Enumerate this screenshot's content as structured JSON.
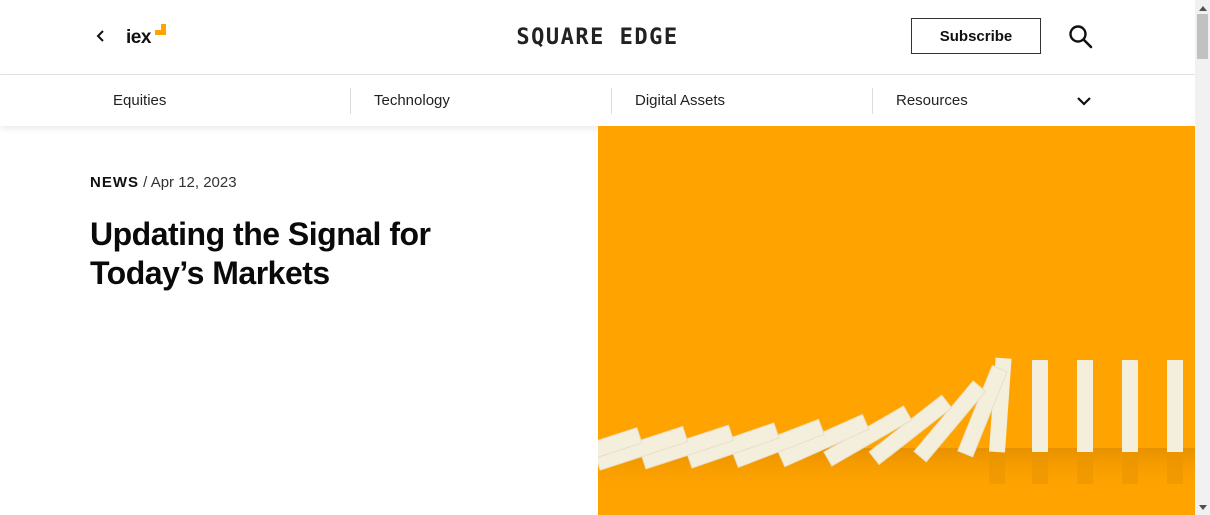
{
  "header": {
    "logo_text": "iex",
    "site_title": "SQUARE EDGE",
    "subscribe_label": "Subscribe",
    "accent_color": "#FFA300"
  },
  "icons": {
    "back": "chevron-left-icon",
    "search": "search-icon",
    "nav_expand": "chevron-down-icon"
  },
  "nav": {
    "items": [
      {
        "label": "Equities"
      },
      {
        "label": "Technology"
      },
      {
        "label": "Digital Assets"
      },
      {
        "label": "Resources"
      }
    ]
  },
  "article": {
    "category": "NEWS",
    "separator": "/",
    "date": "Apr 12, 2023",
    "title": "Updating the Signal for Today’s Markets"
  },
  "hero": {
    "background_color": "#FFA300",
    "domino_color": "#F4EEDC",
    "subject": "falling dominoes"
  }
}
